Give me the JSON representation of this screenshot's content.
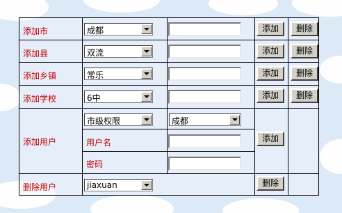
{
  "rows": {
    "city": {
      "label": "添加市",
      "select": "成都",
      "add": "添加",
      "del": "删除"
    },
    "county": {
      "label": "添加县",
      "select": "双流",
      "add": "添加",
      "del": "删除"
    },
    "town": {
      "label": "添加乡镇",
      "select": "常乐",
      "add": "添加",
      "del": "删除"
    },
    "school": {
      "label": "添加学校",
      "select": "6中",
      "add": "添加",
      "del": "删除"
    },
    "user": {
      "label": "添加用户",
      "role_select": "市级权限",
      "scope_select": "成都",
      "username_label": "用户名",
      "password_label": "密码",
      "add": "添加"
    },
    "delete_user": {
      "label": "删除用户",
      "select": "jiaxuan",
      "del": "删除"
    }
  }
}
